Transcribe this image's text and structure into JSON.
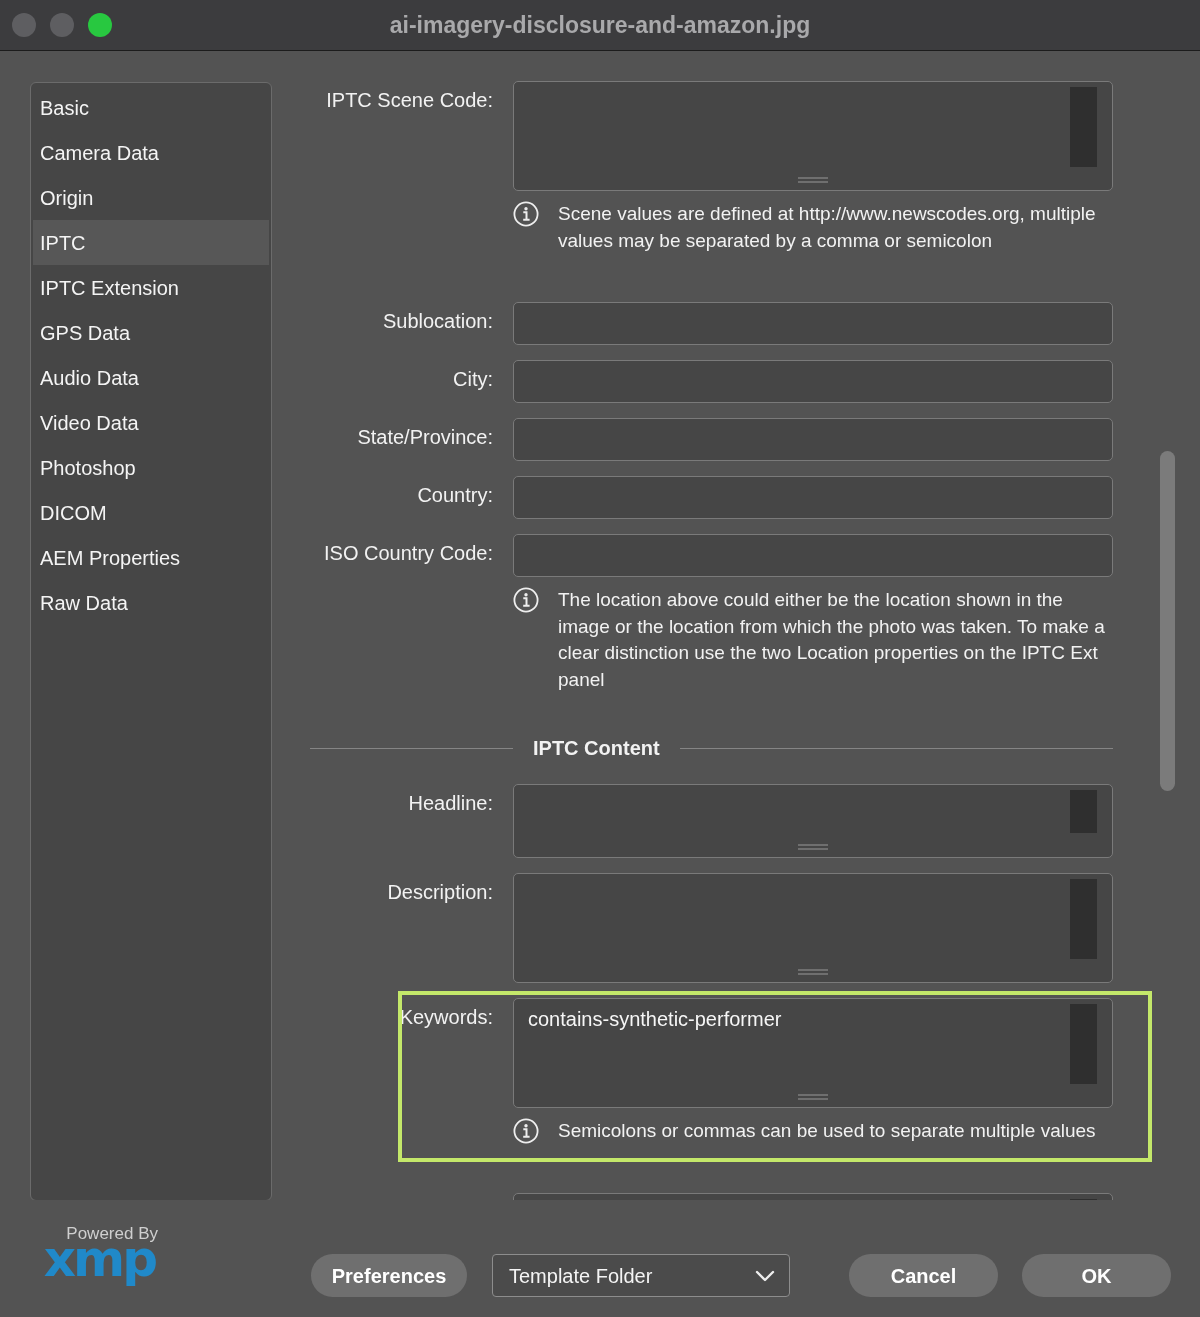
{
  "window": {
    "title": "ai-imagery-disclosure-and-amazon.jpg",
    "controls": [
      {
        "kind": "close",
        "disabled": true
      },
      {
        "kind": "minimize",
        "disabled": true
      },
      {
        "kind": "zoom",
        "disabled": false
      }
    ]
  },
  "sidebar": {
    "items": [
      {
        "label": "Basic",
        "selected": false
      },
      {
        "label": "Camera Data",
        "selected": false
      },
      {
        "label": "Origin",
        "selected": false
      },
      {
        "label": "IPTC",
        "selected": true
      },
      {
        "label": "IPTC Extension",
        "selected": false
      },
      {
        "label": "GPS Data",
        "selected": false
      },
      {
        "label": "Audio Data",
        "selected": false
      },
      {
        "label": "Video Data",
        "selected": false
      },
      {
        "label": "Photoshop",
        "selected": false
      },
      {
        "label": "DICOM",
        "selected": false
      },
      {
        "label": "AEM Properties",
        "selected": false
      },
      {
        "label": "Raw Data",
        "selected": false
      }
    ]
  },
  "form": {
    "rows": [
      {
        "kind": "textarea",
        "label": "IPTC Scene Code:",
        "note": "Scene values are defined at http://www.newscodes.org, multiple values may be separated by a comma or semicolon",
        "highlighted": false
      },
      {
        "kind": "input",
        "label": "Sublocation:",
        "highlighted": false
      },
      {
        "kind": "input",
        "label": "City:",
        "highlighted": false
      },
      {
        "kind": "input",
        "label": "State/Province:",
        "highlighted": false
      },
      {
        "kind": "input",
        "label": "Country:",
        "highlighted": false
      },
      {
        "kind": "input",
        "label": "ISO Country Code:",
        "note": "The location above could either be the location shown in the image or the location from which the photo was taken. To make a clear distinction use the two Location properties on the IPTC Ext panel",
        "highlighted": false
      },
      {
        "kind": "heading",
        "label": "IPTC Content"
      },
      {
        "kind": "textbox",
        "label": "Headline:",
        "highlighted": false
      },
      {
        "kind": "textarea",
        "label": "Description:",
        "highlighted": false
      },
      {
        "kind": "textarea",
        "label": "Keywords:",
        "value": "contains-synthetic-performer",
        "note": "Semicolons or commas can be used to separate multiple values",
        "highlighted": true
      },
      {
        "kind": "textarea",
        "highlighted": false
      }
    ]
  },
  "footer": {
    "powered_by": "Powered By",
    "logo": "xmp",
    "preferences_button": "Preferences",
    "template_menu": {
      "value": "Template Folder"
    },
    "buttons": [
      "Cancel",
      "OK"
    ]
  }
}
